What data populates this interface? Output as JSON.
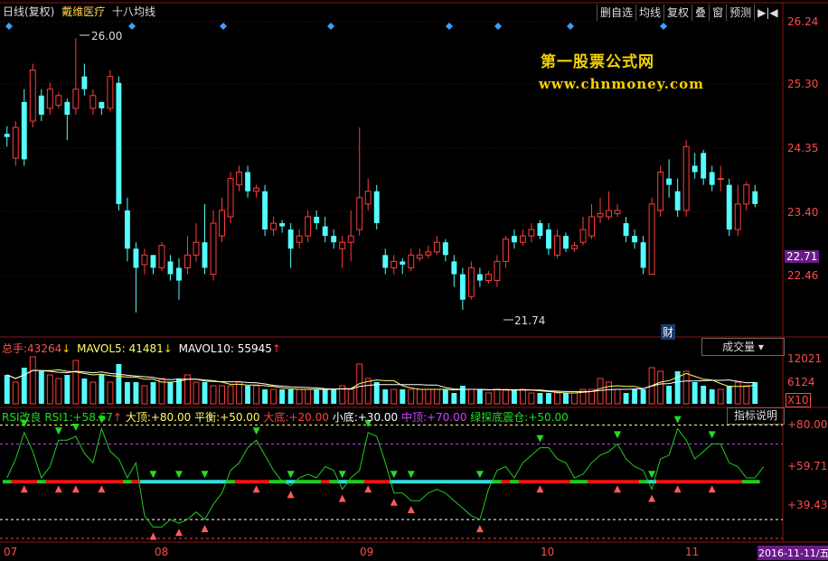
{
  "header": {
    "period": "日线(复权)",
    "stock_name": "戴维医疗",
    "indicator": "十八均线"
  },
  "toolbar": [
    "删自选",
    "均线",
    "复权",
    "叠",
    "窗",
    "预测",
    "▶|◀"
  ],
  "watermark": {
    "line1": "第一股票公式网",
    "line2": "www.chnmoney.com"
  },
  "price_axis": {
    "ticks": [
      "26.24",
      "25.30",
      "24.35",
      "23.40",
      "22.46"
    ],
    "current_price": "22.71"
  },
  "annotations": {
    "high": "26.00",
    "low": "21.74",
    "fin_marker": "财"
  },
  "volume_panel": {
    "total_label": "总手:",
    "total_value": "43264",
    "mavol5_label": "MAVOL5:",
    "mavol5_value": "41481",
    "mavol10_label": "MAVOL10:",
    "mavol10_value": "55945",
    "selector": "成交量 ▾",
    "ticks": [
      "12021",
      "6124"
    ],
    "unit": "X10"
  },
  "rsi_panel": {
    "title": "RSI改良",
    "rsi_label": "RSI1:",
    "rsi_value": "+58.67",
    "top_label": "大顶:",
    "top_value": "+80.00",
    "balance_label": "平衡:",
    "balance_value": "+50.00",
    "bottom_label": "大底:",
    "bottom_value": "+20.00",
    "small_bottom_label": "小底:",
    "small_bottom_value": "+30.00",
    "mid_top_label": "中顶:",
    "mid_top_value": "+70.00",
    "green_label": "绿探底震仓:",
    "green_value": "+50.00",
    "help_button": "指标说明",
    "ticks": [
      "+80.00",
      "+59.71",
      "+39.43"
    ]
  },
  "date_axis": {
    "labels": [
      "07",
      "08",
      "09",
      "10",
      "11"
    ],
    "current_date": "2016-11-11/五"
  },
  "colors": {
    "up": "#ff3c3c",
    "down": "#54fcfc",
    "rsi_line": "#22cc22",
    "balance_red": "#ee1111",
    "balance_cyan": "#33dddd",
    "balance_green": "#22cc22"
  },
  "chart_data": {
    "type": "candlestick",
    "ylim": [
      21.5,
      26.4
    ],
    "candles": [
      {
        "o": 24.5,
        "c": 24.45,
        "h": 24.62,
        "l": 24.3
      },
      {
        "o": 24.12,
        "c": 24.6,
        "h": 24.7,
        "l": 24.0
      },
      {
        "o": 25.0,
        "c": 24.1,
        "h": 25.2,
        "l": 24.0
      },
      {
        "o": 24.7,
        "c": 25.5,
        "h": 25.6,
        "l": 24.6
      },
      {
        "o": 25.1,
        "c": 24.8,
        "h": 25.2,
        "l": 24.7
      },
      {
        "o": 24.9,
        "c": 25.2,
        "h": 25.3,
        "l": 24.8
      },
      {
        "o": 24.95,
        "c": 25.1,
        "h": 25.15,
        "l": 24.9
      },
      {
        "o": 25.0,
        "c": 24.8,
        "h": 25.05,
        "l": 24.4
      },
      {
        "o": 24.9,
        "c": 25.2,
        "h": 26.0,
        "l": 24.8
      },
      {
        "o": 25.4,
        "c": 25.2,
        "h": 25.6,
        "l": 25.1
      },
      {
        "o": 24.9,
        "c": 25.1,
        "h": 25.2,
        "l": 24.8
      },
      {
        "o": 25.0,
        "c": 24.9,
        "h": 25.0,
        "l": 24.8
      },
      {
        "o": 24.9,
        "c": 25.4,
        "h": 25.5,
        "l": 24.85
      },
      {
        "o": 25.3,
        "c": 23.4,
        "h": 25.4,
        "l": 23.3
      },
      {
        "o": 23.3,
        "c": 22.7,
        "h": 23.5,
        "l": 22.5
      },
      {
        "o": 22.7,
        "c": 22.4,
        "h": 22.8,
        "l": 21.7
      },
      {
        "o": 22.45,
        "c": 22.6,
        "h": 22.7,
        "l": 22.3
      },
      {
        "o": 22.6,
        "c": 22.4,
        "h": 22.6,
        "l": 22.3
      },
      {
        "o": 22.4,
        "c": 22.75,
        "h": 22.8,
        "l": 22.35
      },
      {
        "o": 22.5,
        "c": 22.3,
        "h": 22.6,
        "l": 22.2
      },
      {
        "o": 22.4,
        "c": 22.2,
        "h": 22.55,
        "l": 21.9
      },
      {
        "o": 22.4,
        "c": 22.6,
        "h": 22.9,
        "l": 22.3
      },
      {
        "o": 22.6,
        "c": 22.8,
        "h": 23.1,
        "l": 22.5
      },
      {
        "o": 22.8,
        "c": 22.4,
        "h": 23.4,
        "l": 22.3
      },
      {
        "o": 22.3,
        "c": 23.1,
        "h": 23.3,
        "l": 22.2
      },
      {
        "o": 22.9,
        "c": 23.3,
        "h": 23.5,
        "l": 22.8
      },
      {
        "o": 23.2,
        "c": 23.8,
        "h": 23.9,
        "l": 23.1
      },
      {
        "o": 23.7,
        "c": 23.9,
        "h": 24.0,
        "l": 23.6
      },
      {
        "o": 23.9,
        "c": 23.6,
        "h": 24.0,
        "l": 23.5
      },
      {
        "o": 23.6,
        "c": 23.65,
        "h": 23.7,
        "l": 23.5
      },
      {
        "o": 23.6,
        "c": 23.0,
        "h": 23.7,
        "l": 22.9
      },
      {
        "o": 23.0,
        "c": 23.1,
        "h": 23.2,
        "l": 22.9
      },
      {
        "o": 23.1,
        "c": 23.05,
        "h": 23.15,
        "l": 22.95
      },
      {
        "o": 23.0,
        "c": 22.7,
        "h": 23.1,
        "l": 22.4
      },
      {
        "o": 22.8,
        "c": 22.9,
        "h": 23.0,
        "l": 22.7
      },
      {
        "o": 22.9,
        "c": 23.2,
        "h": 23.3,
        "l": 22.8
      },
      {
        "o": 23.2,
        "c": 23.1,
        "h": 23.3,
        "l": 23.0
      },
      {
        "o": 23.05,
        "c": 22.9,
        "h": 23.2,
        "l": 22.8
      },
      {
        "o": 22.9,
        "c": 22.8,
        "h": 23.0,
        "l": 22.7
      },
      {
        "o": 22.7,
        "c": 22.8,
        "h": 22.9,
        "l": 22.4
      },
      {
        "o": 22.8,
        "c": 22.9,
        "h": 23.3,
        "l": 22.5
      },
      {
        "o": 23.0,
        "c": 23.5,
        "h": 24.6,
        "l": 22.9
      },
      {
        "o": 23.4,
        "c": 23.6,
        "h": 23.8,
        "l": 23.3
      },
      {
        "o": 23.6,
        "c": 23.1,
        "h": 23.7,
        "l": 23.0
      },
      {
        "o": 22.6,
        "c": 22.4,
        "h": 22.7,
        "l": 22.3
      },
      {
        "o": 22.4,
        "c": 22.5,
        "h": 22.6,
        "l": 22.3
      },
      {
        "o": 22.5,
        "c": 22.45,
        "h": 22.55,
        "l": 22.3
      },
      {
        "o": 22.4,
        "c": 22.6,
        "h": 22.7,
        "l": 22.35
      },
      {
        "o": 22.55,
        "c": 22.6,
        "h": 22.7,
        "l": 22.5
      },
      {
        "o": 22.6,
        "c": 22.65,
        "h": 22.75,
        "l": 22.55
      },
      {
        "o": 22.65,
        "c": 22.8,
        "h": 22.9,
        "l": 22.6
      },
      {
        "o": 22.8,
        "c": 22.6,
        "h": 22.85,
        "l": 22.5
      },
      {
        "o": 22.5,
        "c": 22.3,
        "h": 22.6,
        "l": 22.1
      },
      {
        "o": 22.3,
        "c": 21.9,
        "h": 22.4,
        "l": 21.74
      },
      {
        "o": 21.95,
        "c": 22.4,
        "h": 22.5,
        "l": 21.9
      },
      {
        "o": 22.3,
        "c": 22.2,
        "h": 22.4,
        "l": 22.1
      },
      {
        "o": 22.2,
        "c": 22.3,
        "h": 22.35,
        "l": 22.15
      },
      {
        "o": 22.2,
        "c": 22.5,
        "h": 22.6,
        "l": 22.1
      },
      {
        "o": 22.5,
        "c": 22.85,
        "h": 22.9,
        "l": 22.4
      },
      {
        "o": 22.9,
        "c": 22.8,
        "h": 23.0,
        "l": 22.7
      },
      {
        "o": 22.8,
        "c": 22.9,
        "h": 23.0,
        "l": 22.75
      },
      {
        "o": 22.9,
        "c": 23.0,
        "h": 23.1,
        "l": 22.8
      },
      {
        "o": 23.1,
        "c": 22.9,
        "h": 23.15,
        "l": 22.85
      },
      {
        "o": 23.0,
        "c": 22.7,
        "h": 23.1,
        "l": 22.6
      },
      {
        "o": 22.6,
        "c": 22.9,
        "h": 23.0,
        "l": 22.55
      },
      {
        "o": 22.9,
        "c": 22.7,
        "h": 22.95,
        "l": 22.65
      },
      {
        "o": 22.7,
        "c": 22.75,
        "h": 22.8,
        "l": 22.65
      },
      {
        "o": 22.8,
        "c": 23.0,
        "h": 23.2,
        "l": 22.75
      },
      {
        "o": 22.9,
        "c": 23.2,
        "h": 23.4,
        "l": 22.85
      },
      {
        "o": 23.2,
        "c": 23.25,
        "h": 23.5,
        "l": 23.1
      },
      {
        "o": 23.2,
        "c": 23.3,
        "h": 23.6,
        "l": 23.15
      },
      {
        "o": 23.25,
        "c": 23.3,
        "h": 23.4,
        "l": 23.2
      },
      {
        "o": 23.1,
        "c": 22.9,
        "h": 23.2,
        "l": 22.8
      },
      {
        "o": 22.9,
        "c": 22.8,
        "h": 23.0,
        "l": 22.7
      },
      {
        "o": 22.8,
        "c": 22.4,
        "h": 22.9,
        "l": 22.3
      },
      {
        "o": 22.3,
        "c": 23.4,
        "h": 23.5,
        "l": 22.3
      },
      {
        "o": 23.3,
        "c": 23.9,
        "h": 24.0,
        "l": 23.2
      },
      {
        "o": 23.8,
        "c": 23.7,
        "h": 24.1,
        "l": 23.5
      },
      {
        "o": 23.6,
        "c": 23.3,
        "h": 23.8,
        "l": 23.2
      },
      {
        "o": 23.3,
        "c": 24.3,
        "h": 24.4,
        "l": 23.2
      },
      {
        "o": 24.0,
        "c": 23.9,
        "h": 24.2,
        "l": 23.8
      },
      {
        "o": 24.2,
        "c": 23.8,
        "h": 24.25,
        "l": 23.7
      },
      {
        "o": 23.9,
        "c": 23.7,
        "h": 24.0,
        "l": 23.6
      },
      {
        "o": 23.8,
        "c": 23.8,
        "h": 24.0,
        "l": 23.6
      },
      {
        "o": 23.7,
        "c": 23.0,
        "h": 23.8,
        "l": 22.9
      },
      {
        "o": 23.0,
        "c": 23.4,
        "h": 23.7,
        "l": 22.9
      },
      {
        "o": 23.4,
        "c": 23.7,
        "h": 23.75,
        "l": 23.3
      },
      {
        "o": 23.6,
        "c": 23.4,
        "h": 23.7,
        "l": 23.35
      }
    ],
    "volume": [
      8,
      6,
      10,
      13,
      9,
      8,
      7,
      8,
      12,
      7,
      6,
      8,
      6,
      11,
      6,
      6,
      5,
      6,
      7,
      6,
      7,
      8,
      6,
      6,
      5,
      5,
      5,
      6,
      5,
      5,
      4,
      4,
      4,
      4,
      4,
      4,
      4,
      4,
      4,
      5,
      4,
      11,
      7,
      6,
      4,
      4,
      4,
      4,
      4,
      4,
      4,
      4,
      3,
      5,
      4,
      4,
      3,
      4,
      4,
      4,
      4,
      3,
      3,
      3,
      3,
      3,
      3,
      4,
      4,
      7,
      6,
      4,
      3,
      4,
      4,
      10,
      9,
      5,
      9,
      9,
      6,
      5,
      4,
      4,
      5,
      6,
      5,
      6
    ],
    "volume_ylim": [
      0,
      13
    ],
    "rsi": [
      52,
      62,
      76,
      66,
      52,
      58,
      72,
      72,
      74,
      65,
      60,
      78,
      66,
      62,
      52,
      60,
      32,
      26,
      26,
      30,
      28,
      30,
      34,
      30,
      38,
      44,
      56,
      60,
      68,
      72,
      64,
      56,
      50,
      48,
      52,
      54,
      52,
      58,
      56,
      46,
      52,
      56,
      76,
      74,
      60,
      44,
      44,
      40,
      40,
      44,
      46,
      44,
      40,
      36,
      32,
      30,
      46,
      56,
      58,
      52,
      60,
      64,
      68,
      68,
      62,
      60,
      52,
      54,
      60,
      64,
      66,
      70,
      62,
      58,
      56,
      46,
      62,
      64,
      78,
      72,
      62,
      66,
      70,
      70,
      60,
      58,
      52,
      52,
      58
    ],
    "rsi_ylim": [
      20,
      85
    ]
  }
}
